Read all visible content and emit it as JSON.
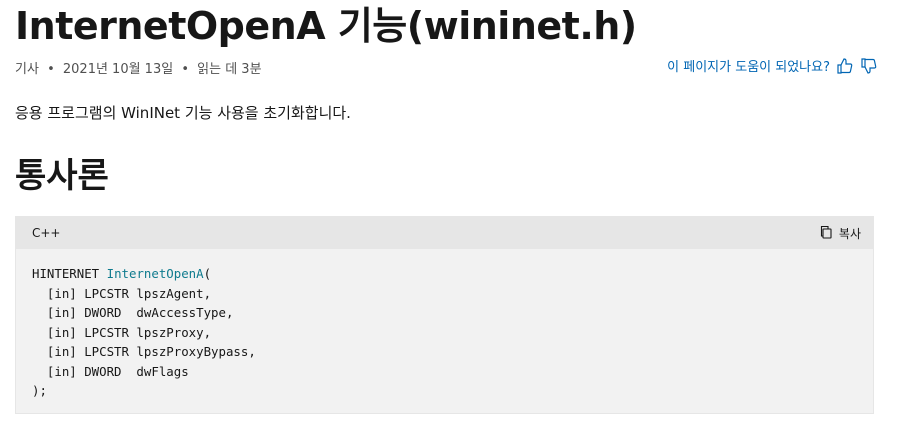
{
  "title": "InternetOpenA 기능(wininet.h)",
  "meta": {
    "type": "기사",
    "date": "2021년 10월 13일",
    "read_time": "읽는 데 3분",
    "separator": "•"
  },
  "feedback": {
    "question": "이 페이지가 도움이 되었나요?",
    "yes_icon": "thumbs-up-icon",
    "no_icon": "thumbs-down-icon"
  },
  "summary": "응용 프로그램의 WinINet 기능 사용을 초기화합니다.",
  "section_heading": "통사론",
  "code": {
    "language": "C++",
    "copy_label": "복사",
    "copy_icon": "copy-icon",
    "lines": [
      [
        "HINTERNET ",
        "InternetOpenA",
        "("
      ],
      [
        "  [in] LPCSTR lpszAgent,"
      ],
      [
        "  [in] DWORD  dwAccessType,"
      ],
      [
        "  [in] LPCSTR lpszProxy,"
      ],
      [
        "  [in] LPCSTR lpszProxyBypass,"
      ],
      [
        "  [in] DWORD  dwFlags"
      ],
      [
        ");"
      ]
    ]
  },
  "colors": {
    "link": "#0065b3",
    "code_bg": "#f2f2f2",
    "code_header_bg": "#e6e6e6",
    "function_name": "#0f7b8e"
  }
}
